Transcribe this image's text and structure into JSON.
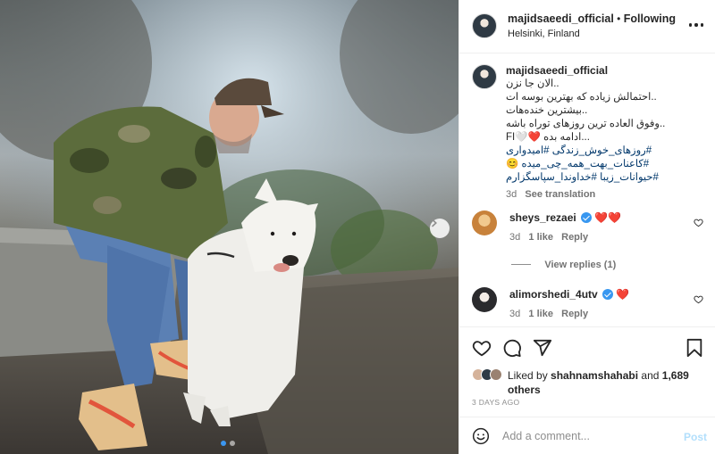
{
  "post": {
    "username": "majidsaeedi_official",
    "separator": "•",
    "following_label": "Following",
    "location": "Helsinki, Finland",
    "more_icon": "more-horizontal-icon"
  },
  "caption": {
    "username": "majidsaeedi_official",
    "lines": [
      "..الان جا نزن",
      "..احتمالش زیاده که بهترین بوسه ات",
      "..بیشترین خنده‌هات",
      "..وفوق العاده ترین روزهای توراه باشه",
      "...ادامه بده ❤️🤍FI",
      "#روزهای_خوش_زندگی #امیدواری",
      "#کاعنات_بهت_همه_چی_میده 😊",
      "#حیوانات_زیبا #خداوندا_سپاسگزارم"
    ],
    "time": "3d",
    "see_translation": "See translation"
  },
  "comments": [
    {
      "username": "sheys_rezaei",
      "text": "❤️❤️",
      "time": "3d",
      "likes": "1 like",
      "reply": "Reply"
    },
    {
      "username": "alimorshedi_4utv",
      "text": "❤️",
      "time": "3d",
      "likes": "1 like",
      "reply": "Reply"
    }
  ],
  "view_replies": "View replies (1)",
  "likes": {
    "prefix": "Liked by ",
    "user": "shahnamshahabi",
    "middle": " and ",
    "count": "1,689",
    "suffix": "others"
  },
  "posted_ago": "3 DAYS AGO",
  "add_comment": {
    "placeholder": "Add a comment...",
    "post_label": "Post"
  },
  "carousel": {
    "slide_count": 2,
    "active_index": 0
  },
  "colors": {
    "link": "#00376b",
    "verified": "#3897f0",
    "heart": "#ed4956",
    "post_disabled": "#b2dffc",
    "muted": "#737373"
  }
}
